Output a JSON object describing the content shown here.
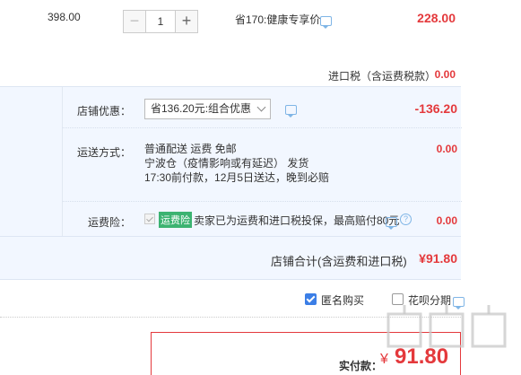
{
  "item": {
    "unit_price": "398.00",
    "quantity": "1",
    "minus_label": "−",
    "plus_label": "+",
    "saving_text": "省170:健康专享价",
    "total": "228.00",
    "import_tax_label": "进口税（含运费税款）",
    "import_tax_value": "0.00"
  },
  "shop": {
    "promo": {
      "label": "店铺优惠：",
      "selected": "省136.20元:组合优惠",
      "value": "-136.20"
    },
    "shipping": {
      "label": "运送方式：",
      "line1": "普通配送 运费 免邮",
      "line2": "宁波仓（疫情影响或有延迟）   发货",
      "line3": "17:30前付款，12月5日送达，晚到必赔",
      "value": "0.00"
    },
    "insurance": {
      "label": "运费险：",
      "badge": "运费险",
      "text": "卖家已为运费和进口税投保，最高赔付80元",
      "help": "?",
      "value": "0.00"
    },
    "total_label": "店铺合计(含运费和进口税)",
    "total_value": "¥91.80"
  },
  "options": {
    "anonymous_label": "匿名购买",
    "anonymous_checked": true,
    "huabei_label": "花呗分期",
    "huabei_checked": false
  },
  "payment": {
    "label": "实付款：",
    "currency": "¥",
    "value": "91.80"
  },
  "colors": {
    "accent_red": "#e4393c",
    "panel_blue": "#f2f7ff",
    "check_blue": "#3b7ee6",
    "badge_green": "#3cb371"
  }
}
